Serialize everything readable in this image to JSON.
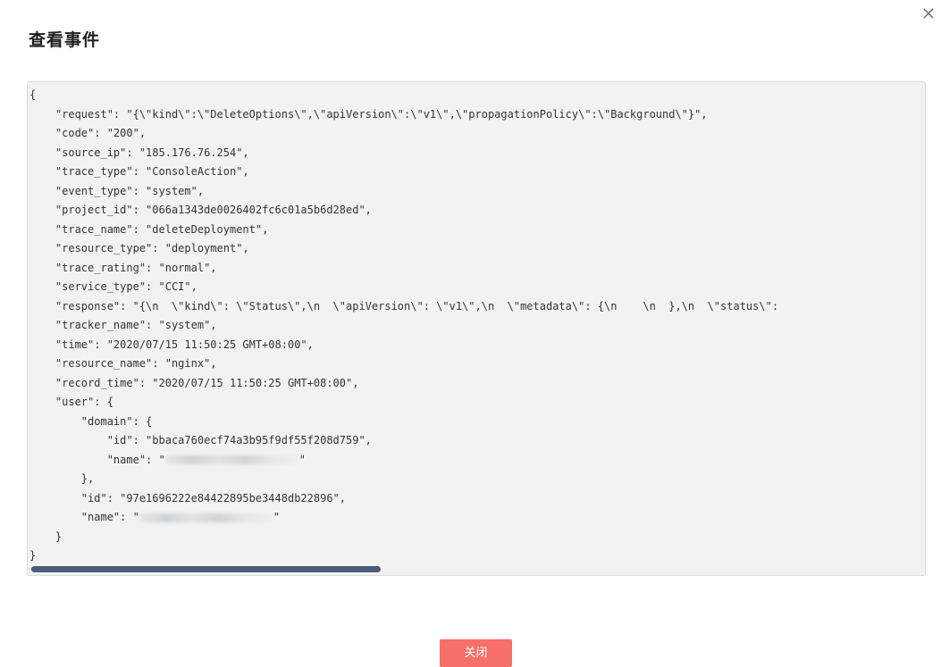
{
  "dialog": {
    "title": "查看事件",
    "close_button_label": "关闭"
  },
  "colors": {
    "primary_button": "#f66f6a",
    "code_background": "#f2f2f2",
    "scrollbar_thumb": "#4d5a79"
  },
  "json_lines": [
    "{",
    "    \"request\": \"{\\\"kind\\\":\\\"DeleteOptions\\\",\\\"apiVersion\\\":\\\"v1\\\",\\\"propagationPolicy\\\":\\\"Background\\\"}\",",
    "    \"code\": \"200\",",
    "    \"source_ip\": \"185.176.76.254\",",
    "    \"trace_type\": \"ConsoleAction\",",
    "    \"event_type\": \"system\",",
    "    \"project_id\": \"066a1343de0026402fc6c01a5b6d28ed\",",
    "    \"trace_name\": \"deleteDeployment\",",
    "    \"resource_type\": \"deployment\",",
    "    \"trace_rating\": \"normal\",",
    "    \"service_type\": \"CCI\",",
    "    \"response\": \"{\\n  \\\"kind\\\": \\\"Status\\\",\\n  \\\"apiVersion\\\": \\\"v1\\\",\\n  \\\"metadata\\\": {\\n    \\n  },\\n  \\\"status\\\":",
    "    \"tracker_name\": \"system\",",
    "    \"time\": \"2020/07/15 11:50:25 GMT+08:00\",",
    "    \"resource_name\": \"nginx\",",
    "    \"record_time\": \"2020/07/15 11:50:25 GMT+08:00\",",
    "    \"user\": {",
    "        \"domain\": {",
    "            \"id\": \"bbaca760ecf74a3b95f9df55f208d759\",",
    "            \"name\": \"",
    "        },",
    "        \"id\": \"97e1696222e84422895be3448db22896\",",
    "        \"name\": \"",
    "    }",
    "}"
  ],
  "redacted_suffix": "\""
}
